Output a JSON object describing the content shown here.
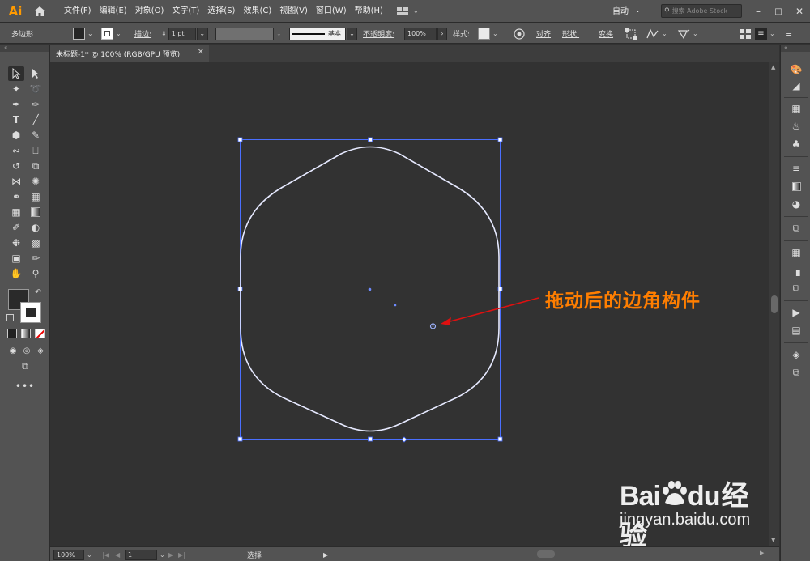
{
  "app": {
    "logo": "Ai"
  },
  "menu": [
    "文件(F)",
    "编辑(E)",
    "对象(O)",
    "文字(T)",
    "选择(S)",
    "效果(C)",
    "视图(V)",
    "窗口(W)",
    "帮助(H)"
  ],
  "workspace": {
    "label": "自动"
  },
  "search": {
    "placeholder": "搜索 Adobe Stock"
  },
  "control": {
    "shape_label": "多边形",
    "stroke_label": "描边:",
    "stroke_weight": "1 pt",
    "brush_label": "基本",
    "opacity_label": "不透明度:",
    "opacity_value": "100%",
    "style_label": "样式:",
    "align_label": "对齐",
    "shape_props_label": "形状:",
    "transform_label": "变换"
  },
  "document": {
    "tab_title": "未标题-1* @ 100% (RGB/GPU 预览)"
  },
  "annotation": {
    "text": "拖动后的边角构件"
  },
  "watermark": {
    "brand": "Bai",
    "brand2": "du",
    "suffix": "经验",
    "url": "jingyan.baidu.com"
  },
  "status": {
    "zoom": "100%",
    "page": "1",
    "tool": "选择"
  },
  "colors": {
    "accent": "#ff7e00",
    "selection": "#4a6fff",
    "shape_stroke": "#e6e9ff",
    "ui_bg": "#535353",
    "canvas_bg": "#323232"
  }
}
